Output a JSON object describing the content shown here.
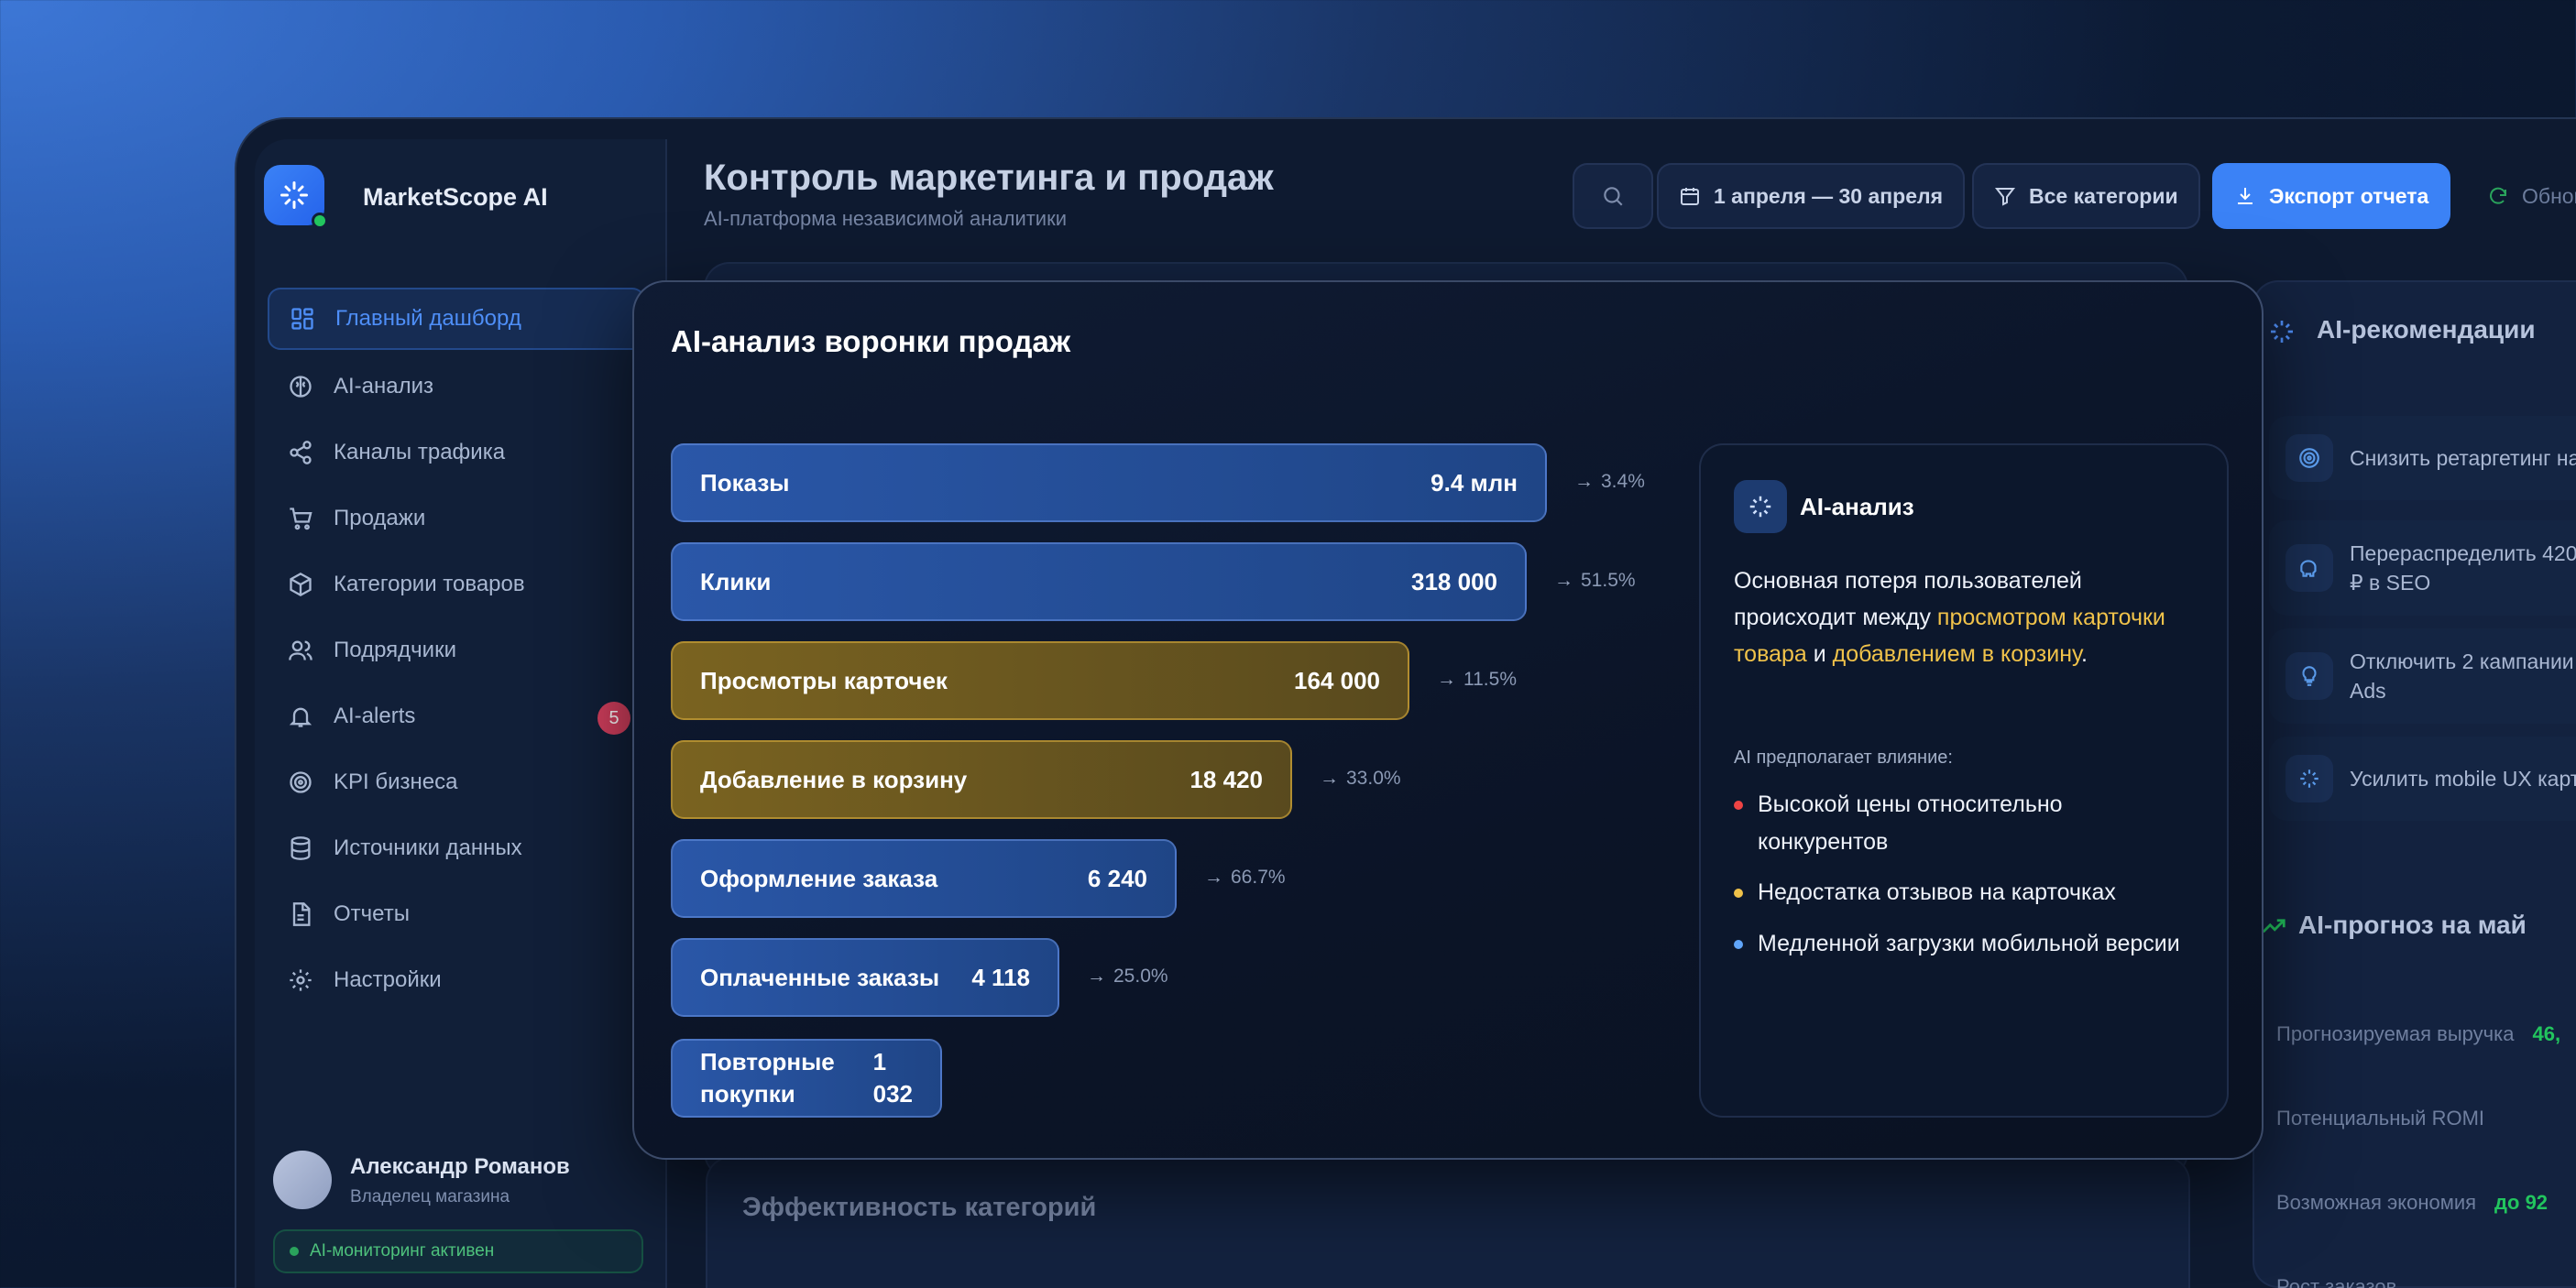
{
  "brand": {
    "name": "MarketScope AI"
  },
  "header": {
    "title": "Контроль маркетинга и продаж",
    "subtitle": "AI-платформа независимой аналитики",
    "date_range": "1 апреля — 30 апреля",
    "categories_filter": "Все категории",
    "export": "Экспорт отчета",
    "refresh": "Обнов"
  },
  "sidebar": {
    "items": [
      {
        "label": "Главный дашборд",
        "icon": "dashboard-icon"
      },
      {
        "label": "AI-анализ",
        "icon": "brain-icon"
      },
      {
        "label": "Каналы трафика",
        "icon": "share-icon"
      },
      {
        "label": "Продажи",
        "icon": "cart-icon"
      },
      {
        "label": "Категории товаров",
        "icon": "box-icon"
      },
      {
        "label": "Подрядчики",
        "icon": "users-icon"
      },
      {
        "label": "AI-alerts",
        "icon": "bell-icon",
        "badge": "5"
      },
      {
        "label": "KPI бизнеса",
        "icon": "target-icon"
      },
      {
        "label": "Источники данных",
        "icon": "database-icon"
      },
      {
        "label": "Отчеты",
        "icon": "file-icon"
      },
      {
        "label": "Настройки",
        "icon": "gear-icon"
      }
    ],
    "user": {
      "name": "Александр Романов",
      "role": "Владелец магазина"
    },
    "ai_status": "AI-мониторинг активен"
  },
  "right_panel": {
    "recommendations_title": "AI-рекомендации",
    "recommendations": [
      {
        "text": "Снизить ретаргетинг на"
      },
      {
        "line1": "Перераспределить 420",
        "line2": "₽ в SEO"
      },
      {
        "line1": "Отключить 2 кампании",
        "line2": "Ads"
      },
      {
        "text": "Усилить mobile UX карт"
      }
    ],
    "forecast_title": "AI-прогноз на май",
    "forecast": [
      {
        "label": "Прогнозируемая выручка",
        "value": "46,"
      },
      {
        "label": "Потенциальный ROMI",
        "value": ""
      },
      {
        "label": "Возможная экономия",
        "value": "до 92"
      },
      {
        "label": "Рост заказов",
        "value": ""
      }
    ]
  },
  "categories_section": {
    "title": "Эффективность категорий"
  },
  "modal": {
    "title": "AI-анализ воронки продаж",
    "funnel": [
      {
        "label": "Показы",
        "value": "9.4 млн",
        "conversion": "3.4%",
        "highlight": false
      },
      {
        "label": "Клики",
        "value": "318 000",
        "conversion": "51.5%",
        "highlight": false
      },
      {
        "label": "Просмотры карточек",
        "value": "164 000",
        "conversion": "11.5%",
        "highlight": true
      },
      {
        "label": "Добавление в корзину",
        "value": "18 420",
        "conversion": "33.0%",
        "highlight": true
      },
      {
        "label": "Оформление заказа",
        "value": "6 240",
        "conversion": "66.7%",
        "highlight": false
      },
      {
        "label": "Оплаченные заказы",
        "value": "4 118",
        "conversion": "25.0%",
        "highlight": false
      },
      {
        "label_line1": "Повторные",
        "label_line2": "покупки",
        "value_line1": "1",
        "value_line2": "032",
        "highlight": false
      }
    ],
    "ai_card": {
      "title": "AI-анализ",
      "text_part1": "Основная потеря пользователей происходит между ",
      "text_hl1": "просмотром карточки товара",
      "text_part2": " и ",
      "text_hl2": "добавлением в корзину",
      "text_part3": ".",
      "subtitle": "AI предполагает влияние:",
      "bullets": [
        {
          "text": "Высокой цены относительно конкурентов",
          "color": "#ef4444"
        },
        {
          "text": "Недостатка отзывов на карточках",
          "color": "#f0c24a"
        },
        {
          "text": "Медленной загрузки мобильной версии",
          "color": "#60a5fa"
        }
      ]
    }
  },
  "colors": {
    "accent": "#3b82f6",
    "highlight": "#f0c24a",
    "success": "#22c55e",
    "danger": "#d43f5e"
  }
}
